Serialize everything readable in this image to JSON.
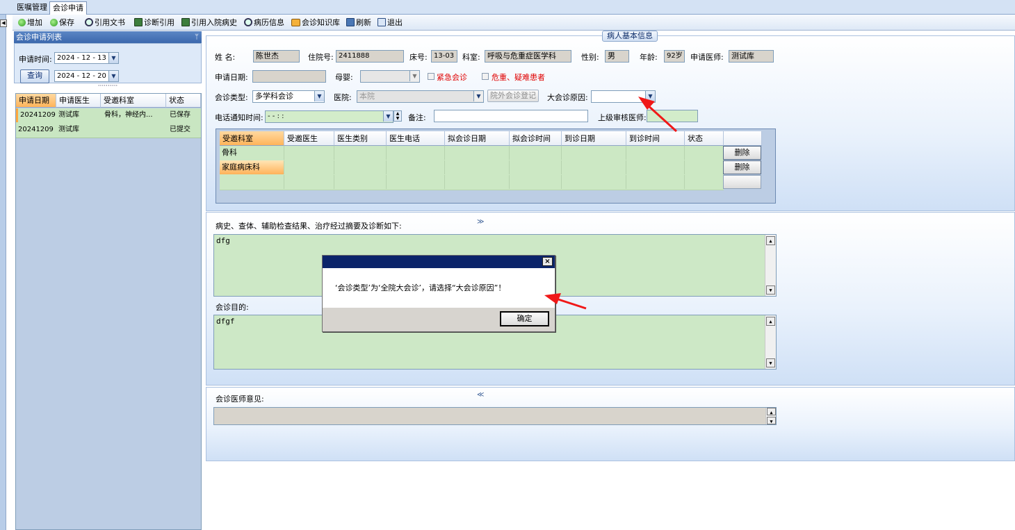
{
  "tabs": [
    {
      "label": "医嘱管理"
    },
    {
      "label": "会诊申请"
    }
  ],
  "toolbar": {
    "add": "增加",
    "save": "保存",
    "cite_doc": "引用文书",
    "cite_diag": "诊断引用",
    "cite_admission": "引用入院病史",
    "record_info": "病历信息",
    "knowledge": "会诊知识库",
    "refresh": "刷新",
    "exit": "退出"
  },
  "left_panel": {
    "title": "会诊申请列表",
    "pin": "ᛘ",
    "time_label": "申请时间:",
    "date_from": "2024 - 12 - 13",
    "date_to": "2024 - 12 - 20",
    "query_button": "查询",
    "grip": "··········",
    "columns": [
      "申请日期",
      "申请医生",
      "受邀科室",
      "状态"
    ],
    "rows": [
      {
        "date": "20241209",
        "doctor": "测试库",
        "dept": "骨科，神经内...",
        "status": "已保存"
      },
      {
        "date": "20241209",
        "doctor": "测试库",
        "dept": "",
        "status": "已提交"
      }
    ]
  },
  "patient": {
    "legend": "病人基本信息",
    "name_label": "姓    名:",
    "name": "陈世杰",
    "admission_no_label": "住院号:",
    "admission_no": "2411888",
    "bed_label": "床号:",
    "bed": "13-03",
    "dept_label": "科室:",
    "dept": "呼吸与危重症医学科",
    "sex_label": "性别:",
    "sex": "男",
    "age_label": "年龄:",
    "age": "92岁",
    "req_doctor_label": "申请医师:",
    "req_doctor": "测试库",
    "apply_date_label": "申请日期:",
    "apply_date": "",
    "baby_label": "母婴:",
    "urgent_label": "紧急会诊",
    "critical_label": "危重、疑难患者",
    "type_label": "会诊类型:",
    "type_value": "多学科会诊",
    "hospital_label": "医院:",
    "hospital_value": "本院",
    "external_button": "院外会诊登记",
    "reason_label": "大会诊原因:",
    "reason_value": "",
    "phone_label": "电话通知时间:",
    "phone_time": "-   -           :    :",
    "remark_label": "备注:",
    "remark_value": "",
    "superior_label": "上级审核医师:"
  },
  "grid": {
    "columns": [
      "受邀科室",
      "受邀医生",
      "医生类别",
      "医生电话",
      "拟会诊日期",
      "拟会诊时间",
      "到诊日期",
      "到诊时间",
      "状态"
    ],
    "rows": [
      {
        "dept": "骨科",
        "button": "删除"
      },
      {
        "dept": "家庭病床科",
        "button": "删除"
      },
      {
        "dept": "",
        "button": ""
      }
    ]
  },
  "history": {
    "label": "病史、查体、辅助检查结果、治疗经过摘要及诊断如下:",
    "chevron": "≫",
    "text": "dfg"
  },
  "purpose": {
    "label": "会诊目的:",
    "text": "dfgf"
  },
  "opinion": {
    "label": "会诊医师意见:",
    "chevron": "≪",
    "text": ""
  },
  "dialog": {
    "close": "×",
    "message": "‘会诊类型’为‘全院大会诊’，请选择“大会诊原因”！",
    "ok": "确定"
  },
  "icons": {
    "dropdown": "▼",
    "scroll_up": "▲",
    "scroll_down": "▼"
  }
}
